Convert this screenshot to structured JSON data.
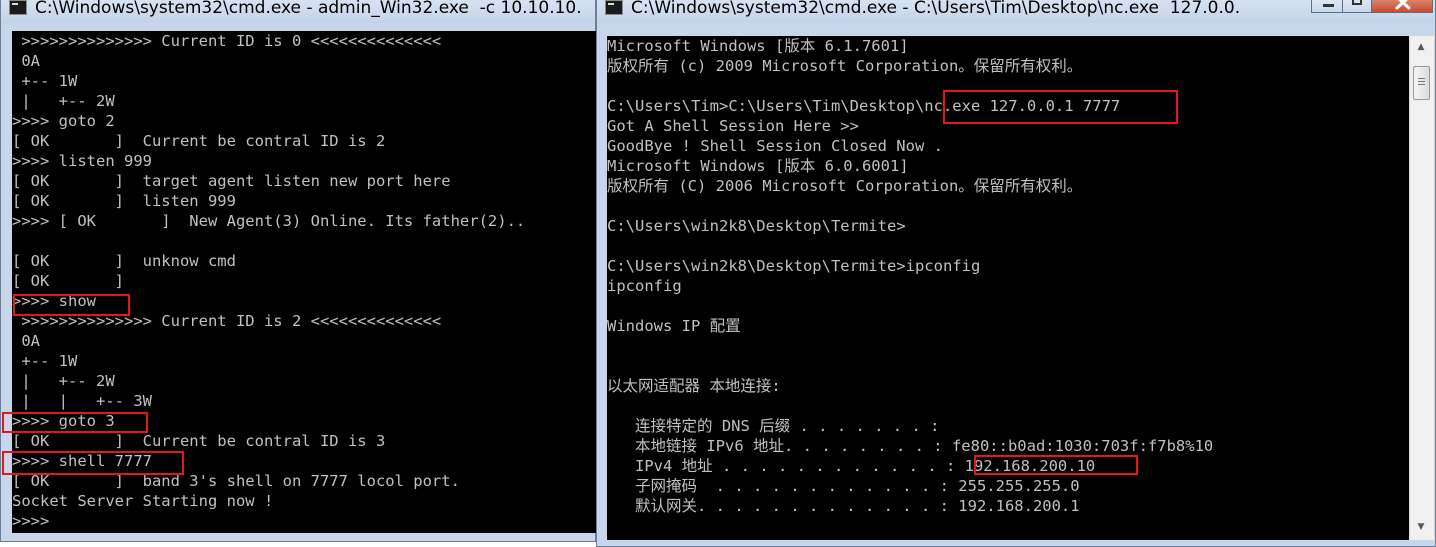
{
  "left_window": {
    "title": "C:\\Windows\\system32\\cmd.exe - admin_Win32.exe  -c 10.10.10.",
    "lines": [
      " >>>>>>>>>>>>>> Current ID is 0 <<<<<<<<<<<<<<",
      " 0A",
      " +-- 1W",
      " |   +-- 2W",
      ">>>> goto 2",
      "[ OK       ]  Current be contral ID is 2",
      ">>>> listen 999",
      "[ OK       ]  target agent listen new port here",
      "[ OK       ]  listen 999",
      ">>>> [ OK       ]  New Agent(3) Online. Its father(2)..",
      "",
      "[ OK       ]  unknow cmd",
      "[ OK       ]",
      ">>>> show",
      " >>>>>>>>>>>>>> Current ID is 2 <<<<<<<<<<<<<<",
      " 0A",
      " +-- 1W",
      " |   +-- 2W",
      " |   |   +-- 3W",
      ">>>> goto 3",
      "[ OK       ]  Current be contral ID is 3",
      ">>>> shell 7777",
      "[ OK       ]  band 3's shell on 7777 locol port.",
      "Socket Server Starting now !",
      ">>>>"
    ]
  },
  "right_window": {
    "title": "C:\\Windows\\system32\\cmd.exe - C:\\Users\\Tim\\Desktop\\nc.exe  127.0.0.",
    "lines": [
      "Microsoft Windows [版本 6.1.7601]",
      "版权所有 (c) 2009 Microsoft Corporation。保留所有权利。",
      "",
      "C:\\Users\\Tim>C:\\Users\\Tim\\Desktop\\nc.exe 127.0.0.1 7777",
      "Got A Shell Session Here >>",
      "GoodBye ! Shell Session Closed Now .",
      "Microsoft Windows [版本 6.0.6001]",
      "版权所有 (C) 2006 Microsoft Corporation。保留所有权利。",
      "",
      "C:\\Users\\win2k8\\Desktop\\Termite>",
      "",
      "C:\\Users\\win2k8\\Desktop\\Termite>ipconfig",
      "ipconfig",
      "",
      "Windows IP 配置",
      "",
      "",
      "以太网适配器 本地连接:",
      "",
      "   连接特定的 DNS 后缀 . . . . . . . :",
      "   本地链接 IPv6 地址. . . . . . . . : fe80::b0ad:1030:703f:f7b8%10",
      "   IPv4 地址 . . . . . . . . . . . . : 192.168.200.10",
      "   子网掩码  . . . . . . . . . . . . : 255.255.255.0",
      "   默认网关. . . . . . . . . . . . . : 192.168.200.1"
    ]
  },
  "icons": [
    "console-window-icon",
    "minimize-icon",
    "maximize-icon",
    "close-icon",
    "scroll-up-arrow-icon",
    "scroll-down-arrow-icon"
  ],
  "colors": {
    "console_bg": "#000000",
    "console_text": "#c0c0c0",
    "highlight": "#e0191f",
    "title_bg": "#c7d6ea"
  }
}
